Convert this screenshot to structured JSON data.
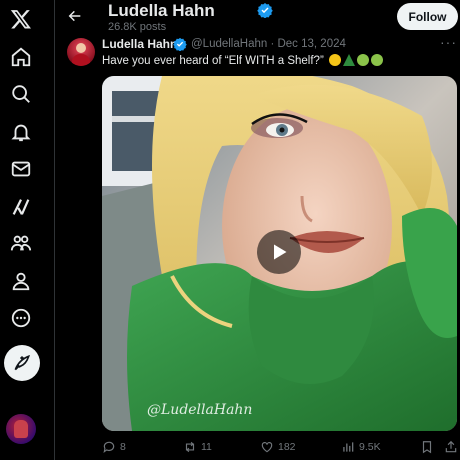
{
  "sidebar": {
    "items": [
      {
        "icon": "x-logo-icon"
      },
      {
        "icon": "home-icon"
      },
      {
        "icon": "search-icon"
      },
      {
        "icon": "notifications-icon"
      },
      {
        "icon": "messages-icon"
      },
      {
        "icon": "grok-icon"
      },
      {
        "icon": "communities-icon"
      },
      {
        "icon": "profile-icon"
      },
      {
        "icon": "more-icon"
      },
      {
        "icon": "compose-post-icon"
      }
    ]
  },
  "header": {
    "name": "Ludella Hahn",
    "post_count": "26.8K posts",
    "follow_label": "Follow"
  },
  "post": {
    "author": "Ludella Hahn",
    "handle_date": "@LudellaHahn · Dec 13, 2024",
    "text": "Have you ever heard of “Elf WITH a Shelf?” ",
    "media_watermark": "@LudellaHahn",
    "actions": {
      "replies": "8",
      "reposts": "11",
      "likes": "182",
      "views": "9.5K"
    }
  },
  "colors": {
    "background": "#000000",
    "text_primary": "#e7e9ea",
    "text_secondary": "#71767b",
    "verified_blue": "#1d9bf0",
    "sweater_green": "#2e8b3e"
  }
}
